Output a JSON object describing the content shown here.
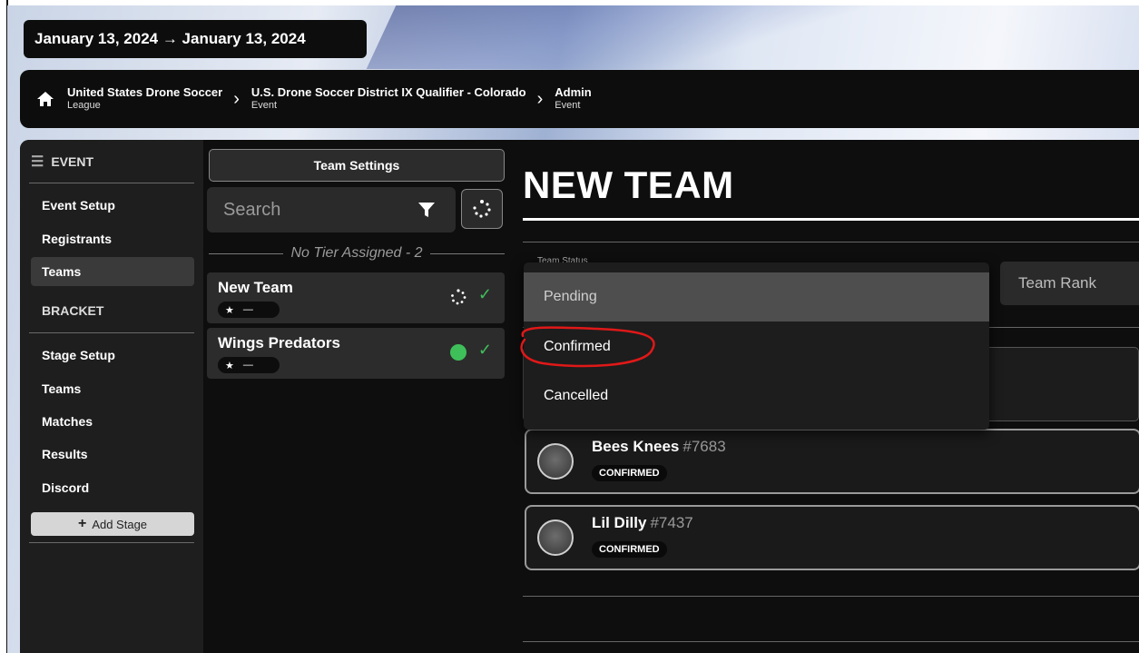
{
  "date_range": "January 13, 2024 → January 13, 2024",
  "breadcrumb": [
    {
      "title": "United States Drone Soccer",
      "subtitle": "League"
    },
    {
      "title": "U.S. Drone Soccer District IX Qualifier - Colorado",
      "subtitle": "Event"
    },
    {
      "title": "Admin",
      "subtitle": "Event"
    }
  ],
  "nav": {
    "event_header": "EVENT",
    "event_items": [
      "Event Setup",
      "Registrants",
      "Teams"
    ],
    "active_item": "Teams",
    "bracket_header": "BRACKET",
    "bracket_items": [
      "Stage Setup",
      "Teams",
      "Matches",
      "Results",
      "Discord"
    ],
    "add_stage_label": "Add Stage"
  },
  "team_list": {
    "settings_label": "Team Settings",
    "search_placeholder": "Search",
    "tier_label": "No Tier Assigned - 2",
    "teams": [
      {
        "name": "New Team",
        "rank": "—",
        "status": "pending"
      },
      {
        "name": "Wings Predators",
        "rank": "—",
        "status": "confirmed"
      }
    ]
  },
  "main": {
    "title": "NEW TEAM",
    "status_label": "Team Status",
    "team_rank_placeholder": "Team Rank",
    "members": [
      {
        "name": "Bees Knees",
        "number": "#7683",
        "status": "CONFIRMED"
      },
      {
        "name": "Lil Dilly",
        "number": "#7437",
        "status": "CONFIRMED"
      }
    ]
  },
  "dropdown": {
    "options": [
      "Pending",
      "Confirmed",
      "Cancelled"
    ],
    "selected": "Pending",
    "annotated": "Confirmed"
  },
  "colors": {
    "accent_green": "#3fbf5a",
    "annotation_red": "#e01818",
    "panel_dark": "#0e0e0e",
    "nav_bg": "#1e1e1e"
  }
}
